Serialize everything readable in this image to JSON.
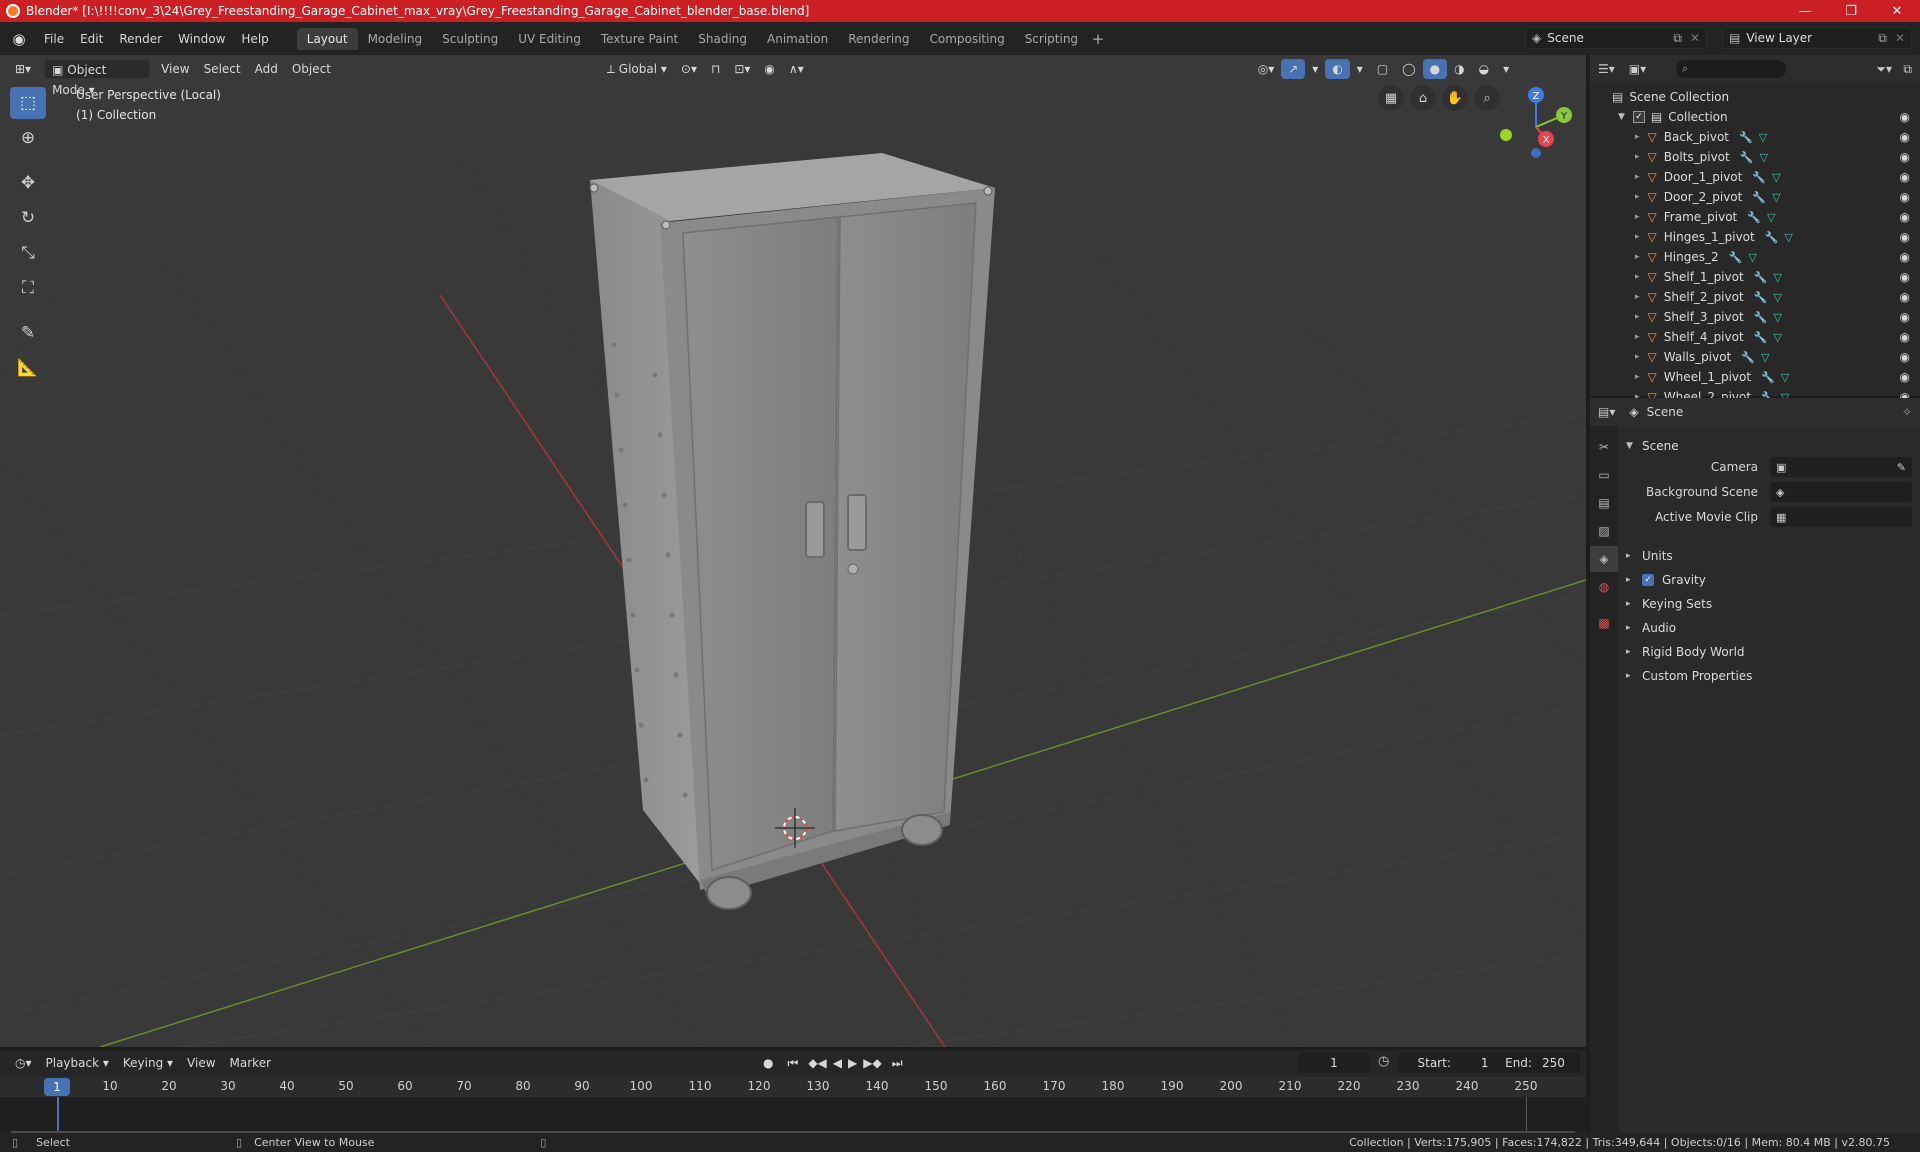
{
  "window": {
    "title": "Blender* [I:\\!!!!conv_3\\24\\Grey_Freestanding_Garage_Cabinet_max_vray\\Grey_Freestanding_Garage_Cabinet_blender_base.blend]",
    "minimize": "—",
    "maximize": "❐",
    "close": "✕"
  },
  "menu": [
    "File",
    "Edit",
    "Render",
    "Window",
    "Help"
  ],
  "workspaces": [
    "Layout",
    "Modeling",
    "Sculpting",
    "UV Editing",
    "Texture Paint",
    "Shading",
    "Animation",
    "Rendering",
    "Compositing",
    "Scripting"
  ],
  "active_workspace": "Layout",
  "scene_selector": "Scene",
  "view_layer": "View Layer",
  "viewport": {
    "mode": "Object Mode",
    "menus": [
      "View",
      "Select",
      "Add",
      "Object"
    ],
    "transform_orientation": "Global",
    "perspective_label": "User Perspective (Local)",
    "collection_label": "(1) Collection",
    "gizmo_axes": {
      "x": "X",
      "y": "Y",
      "z": "Z"
    }
  },
  "outliner": {
    "root": "Scene Collection",
    "collection": "Collection",
    "objects": [
      "Back_pivot",
      "Bolts_pivot",
      "Door_1_pivot",
      "Door_2_pivot",
      "Frame_pivot",
      "Hinges_1_pivot",
      "Hinges_2",
      "Shelf_1_pivot",
      "Shelf_2_pivot",
      "Shelf_3_pivot",
      "Shelf_4_pivot",
      "Walls_pivot",
      "Wheel_1_pivot",
      "Wheel_2_pivot"
    ]
  },
  "properties": {
    "context": "Scene",
    "panel": "Scene",
    "fields": {
      "camera": "Camera",
      "background_scene": "Background Scene",
      "active_movie_clip": "Active Movie Clip"
    },
    "subpanels": [
      "Units",
      "Gravity",
      "Keying Sets",
      "Audio",
      "Rigid Body World",
      "Custom Properties"
    ],
    "gravity_checked": true
  },
  "timeline": {
    "menus": [
      "Playback",
      "Keying",
      "View",
      "Marker"
    ],
    "current_frame": "1",
    "start_label": "Start:",
    "start": "1",
    "end_label": "End:",
    "end": "250",
    "ticks": [
      "10",
      "20",
      "30",
      "40",
      "50",
      "60",
      "70",
      "80",
      "90",
      "100",
      "110",
      "120",
      "130",
      "140",
      "150",
      "160",
      "170",
      "180",
      "190",
      "200",
      "210",
      "220",
      "230",
      "240",
      "250"
    ]
  },
  "status": {
    "left": "Select",
    "middle": "Center View to Mouse",
    "right": "Collection | Verts:175,905 | Faces:174,822 | Tris:349,644 | Objects:0/16 | Mem: 80.4 MB | v2.80.75"
  },
  "colors": {
    "accent": "#4772b3",
    "titlebar": "#cc1f23",
    "x_axis": "#e8434f",
    "y_axis": "#8bc63f",
    "z_axis": "#3d7be0",
    "object_icon": "#f0963a"
  }
}
